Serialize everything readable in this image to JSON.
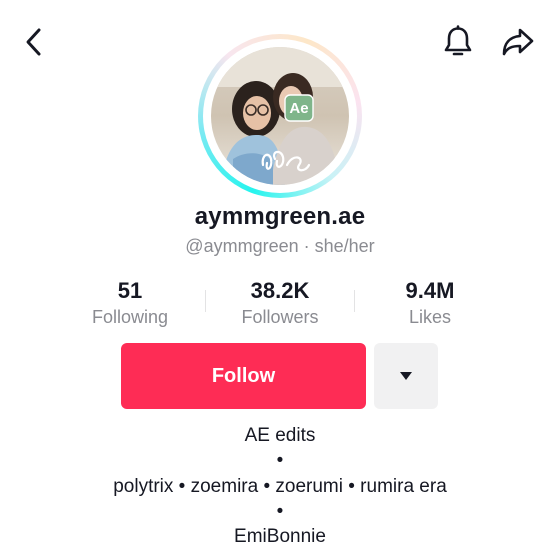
{
  "profile": {
    "display_name": "aymmgreen.ae",
    "handle": "@aymmgreen",
    "separator": "·",
    "pronouns": "she/her",
    "avatar_badge": "Ae",
    "avatar_signature": "ℓɕ"
  },
  "stats": [
    {
      "value": "51",
      "label": "Following"
    },
    {
      "value": "38.2K",
      "label": "Followers"
    },
    {
      "value": "9.4M",
      "label": "Likes"
    }
  ],
  "actions": {
    "follow_label": "Follow"
  },
  "bio": {
    "lines": [
      "AE edits",
      "•",
      "polytrix • zoemira • zoerumi • rumira era",
      "•",
      "EmiBonnie"
    ]
  },
  "icons": {
    "back": "chevron-left-icon",
    "notifications": "bell-icon",
    "share": "share-arrow-icon",
    "more": "caret-down-icon"
  },
  "colors": {
    "follow": "#fe2c55",
    "text": "#161823",
    "muted": "#8a8b91",
    "ring_accent": "#25f4ee"
  }
}
